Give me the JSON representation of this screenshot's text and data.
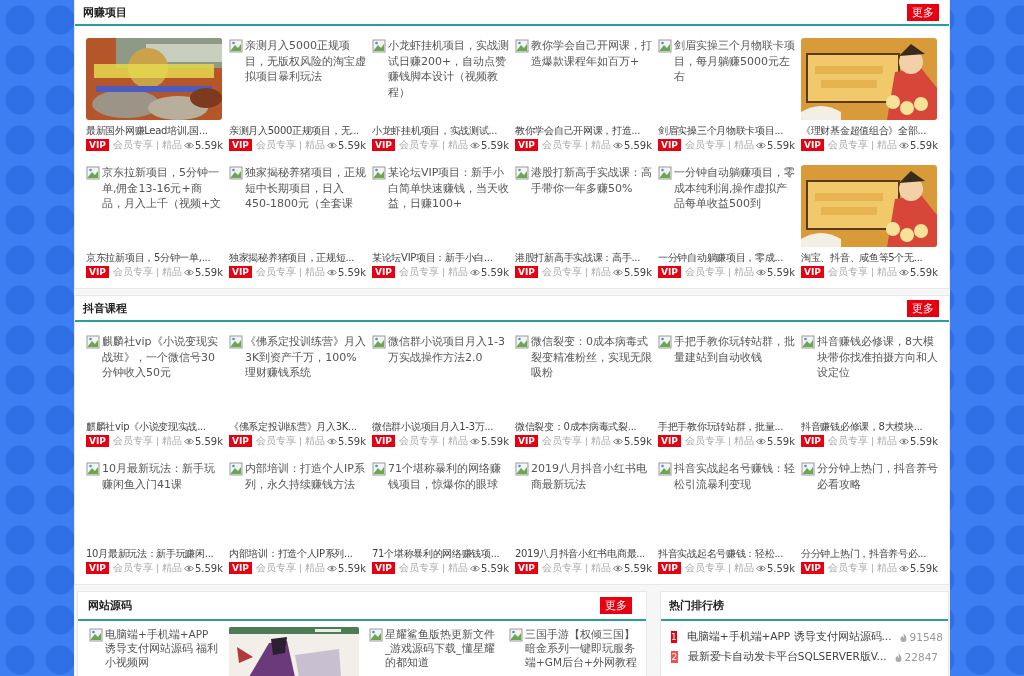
{
  "sections": [
    {
      "title": "网赚项目",
      "more": "更多",
      "items": [
        {
          "kind": "picture",
          "title": "最新国外网赚Lead培训,国...",
          "badge": "VIP",
          "tags": "会员专享 | 精品",
          "views": "5.59k"
        },
        {
          "kind": "broken",
          "alt": "亲测月入5000正规项目，无版权风险的淘宝虚拟项目暴利玩法",
          "title": "亲测月入5000正规项目，无...",
          "badge": "VIP",
          "tags": "会员专享 | 精品",
          "views": "5.59k"
        },
        {
          "kind": "broken",
          "alt": "小龙虾挂机项目，实战测试日赚200+，自动点赞赚钱脚本设计（视频教程）",
          "title": "小龙虾挂机项目，实战测试...",
          "badge": "VIP",
          "tags": "会员专享 | 精品",
          "views": "5.59k"
        },
        {
          "kind": "broken",
          "alt": "教你学会自己开网课，打造爆款课程年如百万+",
          "title": "教你学会自己开网课，打造...",
          "badge": "VIP",
          "tags": "会员专享 | 精品",
          "views": "5.59k"
        },
        {
          "kind": "broken",
          "alt": "剑眉实操三个月物联卡项目，每月躺赚5000元左右",
          "title": "剑眉实操三个月物联卡项目...",
          "badge": "VIP",
          "tags": "会员专享 | 精品",
          "views": "5.59k"
        },
        {
          "kind": "picture",
          "title": "《理财基金超值组合》全部...",
          "badge": "VIP",
          "tags": "会员专享 | 精品",
          "views": "5.59k"
        },
        {
          "kind": "broken",
          "alt": "京东拉新项目，5分钟一单,佣金13-16元+商品，月入上千（视频+文",
          "title": "京东拉新项目，5分钟一单,...",
          "badge": "VIP",
          "tags": "会员专享 | 精品",
          "views": "5.59k"
        },
        {
          "kind": "broken",
          "alt": "独家揭秘养猪项目，正规短中长期项目，日入450-1800元（全套课",
          "title": "独家揭秘养猪项目，正规短...",
          "badge": "VIP",
          "tags": "会员专享 | 精品",
          "views": "5.59k"
        },
        {
          "kind": "broken",
          "alt": "某论坛VIP项目：新手小白简单快速赚钱，当天收益，日赚100+",
          "title": "某论坛VIP项目：新手小白...",
          "badge": "VIP",
          "tags": "会员专享 | 精品",
          "views": "5.59k"
        },
        {
          "kind": "broken",
          "alt": "港股打新高手实战课：高手带你一年多赚50%",
          "title": "港股打新高手实战课：高手...",
          "badge": "VIP",
          "tags": "会员专享 | 精品",
          "views": "5.59k"
        },
        {
          "kind": "broken",
          "alt": "一分钟自动躺赚项目，零成本纯利润,操作虚拟产品每单收益500到",
          "title": "一分钟自动躺赚项目，零成...",
          "badge": "VIP",
          "tags": "会员专享 | 精品",
          "views": "5.59k"
        },
        {
          "kind": "picture",
          "title": "淘宝、抖音、咸鱼等5个无...",
          "badge": "VIP",
          "tags": "会员专享 | 精品",
          "views": "5.59k"
        }
      ]
    },
    {
      "title": "抖音课程",
      "more": "更多",
      "items": [
        {
          "kind": "broken",
          "alt": "麒麟社vip《小说变现实战班》，一个微信号30分钟收入50元",
          "title": "麒麟社vip《小说变现实战...",
          "badge": "VIP",
          "tags": "会员专享 | 精品",
          "views": "5.59k"
        },
        {
          "kind": "broken",
          "alt": "《佛系定投训练营》月入3K到资产千万，100%理财赚钱系统",
          "title": "《佛系定投训练营》月入3K...",
          "badge": "VIP",
          "tags": "会员专享 | 精品",
          "views": "5.59k"
        },
        {
          "kind": "broken",
          "alt": "微信群小说项目月入1-3万实战操作方法2.0",
          "title": "微信群小说项目月入1-3万...",
          "badge": "VIP",
          "tags": "会员专享 | 精品",
          "views": "5.59k"
        },
        {
          "kind": "broken",
          "alt": "微信裂变：0成本病毒式裂变精准粉丝，实现无限吸粉",
          "title": "微信裂变：0成本病毒式裂...",
          "badge": "VIP",
          "tags": "会员专享 | 精品",
          "views": "5.59k"
        },
        {
          "kind": "broken",
          "alt": "手把手教你玩转站群，批量建站到自动收钱",
          "title": "手把手教你玩转站群，批量...",
          "badge": "VIP",
          "tags": "会员专享 | 精品",
          "views": "5.59k"
        },
        {
          "kind": "broken",
          "alt": "抖音赚钱必修课，8大模块带你找准拍摄方向和人设定位",
          "title": "抖音赚钱必修课，8大模块...",
          "badge": "VIP",
          "tags": "会员专享 | 精品",
          "views": "5.59k"
        },
        {
          "kind": "broken",
          "alt": "10月最新玩法：新手玩赚闲鱼入门41课",
          "title": "10月最新玩法：新手玩赚闲...",
          "badge": "VIP",
          "tags": "会员专享 | 精品",
          "views": "5.59k"
        },
        {
          "kind": "broken",
          "alt": "内部培训：打造个人IP系列，永久持续赚钱方法",
          "title": "内部培训：打造个人IP系列...",
          "badge": "VIP",
          "tags": "会员专享 | 精品",
          "views": "5.59k"
        },
        {
          "kind": "broken",
          "alt": "71个堪称暴利的网络赚钱项目，惊爆你的眼球",
          "title": "71个堪称暴利的网络赚钱项...",
          "badge": "VIP",
          "tags": "会员专享 | 精品",
          "views": "5.59k"
        },
        {
          "kind": "broken",
          "alt": "2019八月抖音小红书电商最新玩法",
          "title": "2019八月抖音小红书电商最...",
          "badge": "VIP",
          "tags": "会员专享 | 精品",
          "views": "5.59k"
        },
        {
          "kind": "broken",
          "alt": "抖音实战起名号赚钱：轻松引流暴利变现",
          "title": "抖音实战起名号赚钱：轻松...",
          "badge": "VIP",
          "tags": "会员专享 | 精品",
          "views": "5.59k"
        },
        {
          "kind": "broken",
          "alt": "分分钟上热门，抖音养号必看攻略",
          "title": "分分钟上热门，抖音养号必...",
          "badge": "VIP",
          "tags": "会员专享 | 精品",
          "views": "5.59k"
        }
      ]
    }
  ],
  "source_section": {
    "title": "网站源码",
    "more": "更多",
    "items": [
      {
        "kind": "broken",
        "alt": "电脑端+手机端+APP 诱导支付网站源码 福利小视频网"
      },
      {
        "kind": "picture"
      },
      {
        "kind": "broken",
        "alt": "星耀鲨鱼版热更新文件_游戏源码下载_懂星耀的都知道"
      },
      {
        "kind": "broken",
        "alt": "三国手游【权倾三国】暗金系列一键即玩服务端+GM后台+外网教程"
      }
    ]
  },
  "ranking": {
    "title": "热门排行榜",
    "items": [
      {
        "rank": "1",
        "title": "电脑端+手机端+APP 诱导支付网站源码...",
        "count": "91548",
        "color": "#e60012"
      },
      {
        "rank": "2",
        "title": "最新爱卡自动发卡平台SQLSERVER版V...",
        "count": "22847",
        "color": "#ef5350"
      }
    ]
  }
}
